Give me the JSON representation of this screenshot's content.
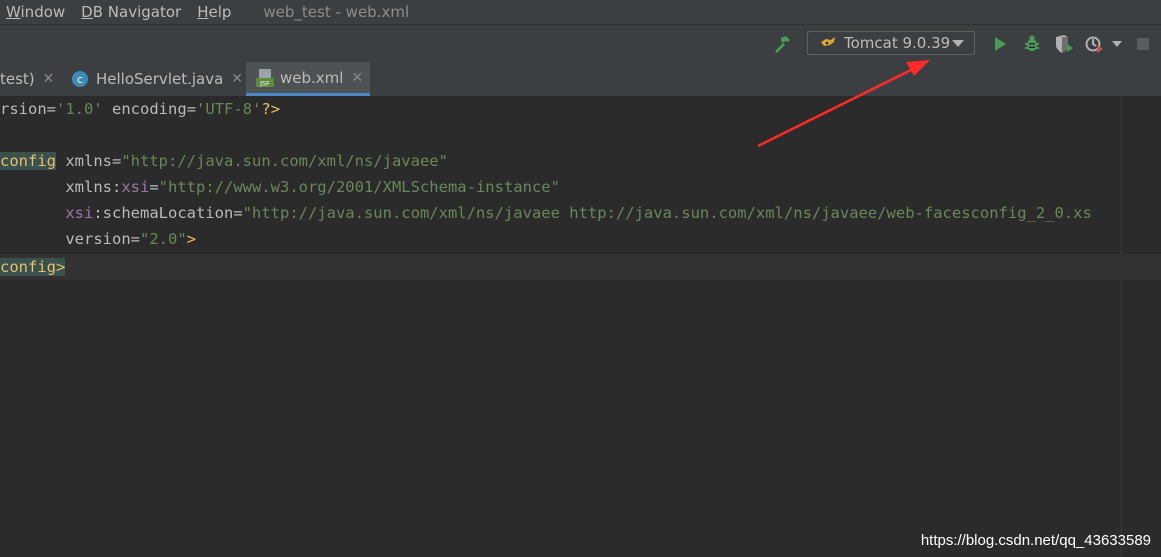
{
  "menubar": {
    "items": [
      {
        "label_prefix": "",
        "mnemonic": "W",
        "label_rest": "indow"
      },
      {
        "label_prefix": "",
        "mnemonic": "D",
        "label_rest": "B Navigator"
      },
      {
        "label_prefix": "",
        "mnemonic": "H",
        "label_rest": "elp"
      }
    ],
    "window_title": "web_test - web.xml"
  },
  "toolbar": {
    "run_config_label": "Tomcat 9.0.39",
    "icons": [
      "build-hammer-icon",
      "run-icon",
      "debug-icon",
      "coverage-icon",
      "profile-icon",
      "stop-icon"
    ],
    "colors": {
      "run": "#499c54",
      "build": "#499c54",
      "stop": "#6e6e6e"
    }
  },
  "tabs": [
    {
      "label": "test)",
      "active": false
    },
    {
      "label": "HelloServlet.java",
      "active": false
    },
    {
      "label": "web.xml",
      "active": true
    }
  ],
  "editor": {
    "lines": {
      "l1": {
        "a": "rsion",
        "b": "=",
        "c": "'1.0'",
        "d": " encoding",
        "e": "=",
        "f": "'UTF-8'",
        "g": "?>"
      },
      "l3": {
        "tag": "config",
        "attr": " xmlns",
        "eq": "=",
        "val": "\"http://java.sun.com/xml/ns/javaee\""
      },
      "l4": {
        "pad": "       ",
        "attr": "xmlns:",
        "ns": "xsi",
        "eq": "=",
        "val": "\"http://www.w3.org/2001/XMLSchema-instance\""
      },
      "l5": {
        "pad": "       ",
        "ns": "xsi",
        "attr": ":schemaLocation",
        "eq": "=",
        "val": "\"http://java.sun.com/xml/ns/javaee http://java.sun.com/xml/ns/javaee/web-facesconfig_2_0.xs"
      },
      "l6": {
        "pad": "       ",
        "attr": "version",
        "eq": "=",
        "val": "\"2.0\"",
        "end": ">"
      },
      "l7": {
        "tag": "config>"
      }
    }
  },
  "annotation": {
    "arrow_color": "#ff2a2a"
  },
  "watermark": "https://blog.csdn.net/qq_43633589"
}
